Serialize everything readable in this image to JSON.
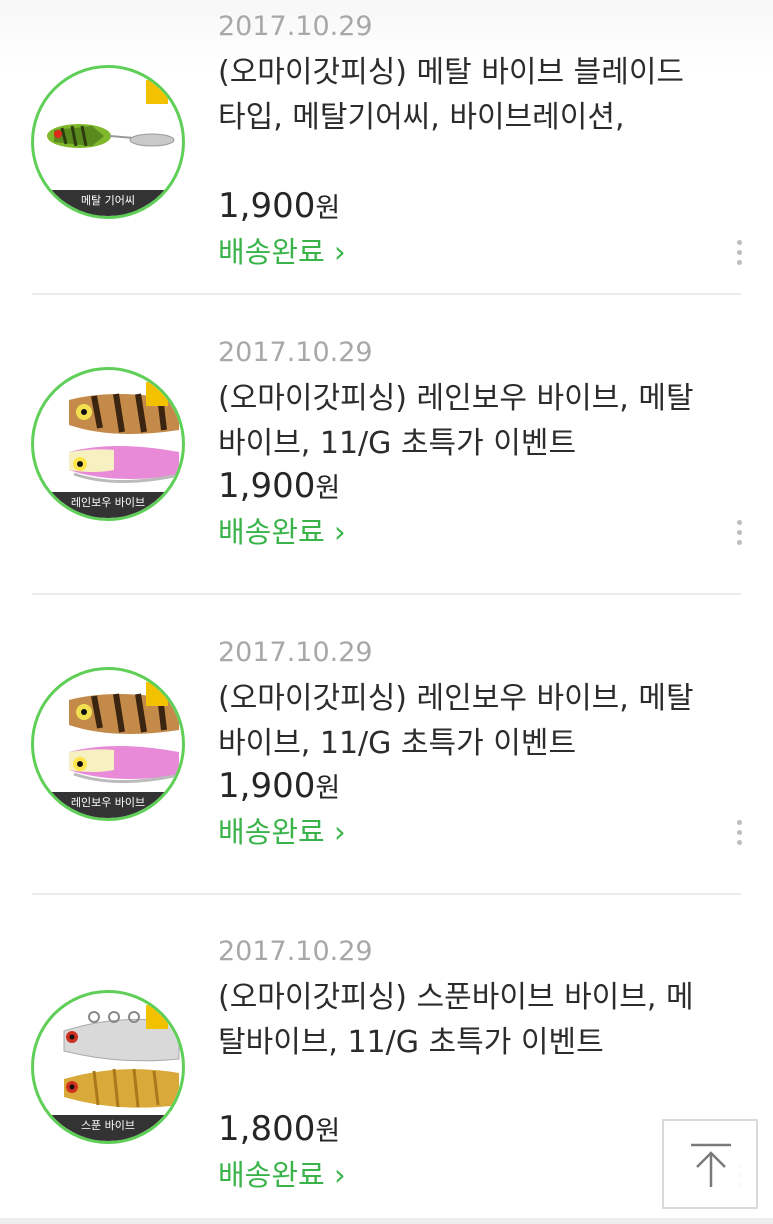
{
  "orders": [
    {
      "date": "2017.10.29",
      "title": "(오마이갓피싱) 메탈 바이브 블레이드 타입, 메탈기어씨, 바이브레이션,",
      "price_number": "1,900",
      "price_unit": "원",
      "status": "배송완료 ›",
      "thumb_caption": "메탈 기어씨"
    },
    {
      "date": "2017.10.29",
      "title": "(오마이갓피싱) 레인보우 바이브, 메탈바이브, 11/G 초특가 이벤트",
      "price_number": "1,900",
      "price_unit": "원",
      "status": "배송완료 ›",
      "thumb_caption": "레인보우 바이브"
    },
    {
      "date": "2017.10.29",
      "title": "(오마이갓피싱) 레인보우 바이브, 메탈바이브, 11/G 초특가 이벤트",
      "price_number": "1,900",
      "price_unit": "원",
      "status": "배송완료 ›",
      "thumb_caption": "레인보우 바이브"
    },
    {
      "date": "2017.10.29",
      "title": "(오마이갓피싱) 스푼바이브 바이브, 메탈바이브, 11/G 초특가 이벤트",
      "price_number": "1,800",
      "price_unit": "원",
      "status": "배송완료 ›",
      "thumb_caption": "스푼 바이브"
    }
  ],
  "icons": {
    "more": "more-vertical-icon",
    "scroll_top": "arrow-up-to-top-icon"
  },
  "colors": {
    "accent_green": "#3ab44a",
    "thumb_ring": "#5fcf57",
    "date_gray": "#a8a8a8"
  }
}
